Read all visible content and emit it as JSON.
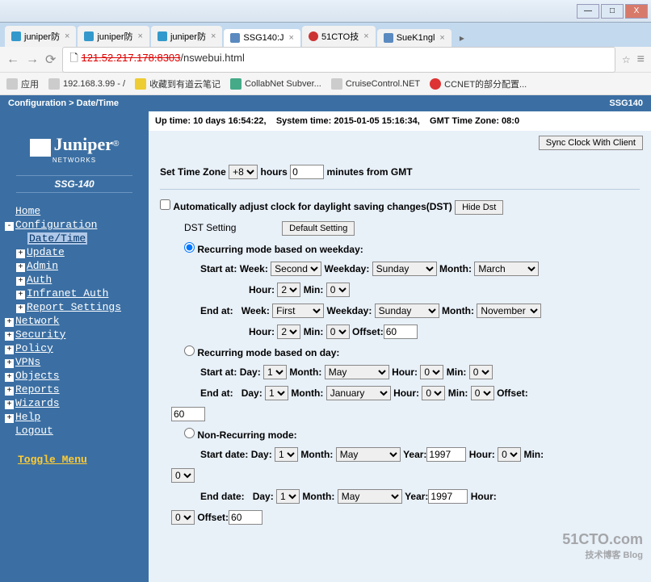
{
  "window": {
    "min": "—",
    "max": "□",
    "close": "X"
  },
  "tabs": [
    {
      "label": "juniper防"
    },
    {
      "label": "juniper防"
    },
    {
      "label": "juniper防"
    },
    {
      "label": "SSG140:J",
      "active": true
    },
    {
      "label": "51CTO技"
    },
    {
      "label": "SueK1ngl"
    }
  ],
  "addr": {
    "url_suffix": "/nswebui.html",
    "star": "☆"
  },
  "bookmarks": {
    "apps": "应用",
    "ip": "192.168.3.99 - /",
    "youdao": "收藏到有道云笔记",
    "collab": "CollabNet Subver...",
    "cruise": "CruiseControl.NET",
    "ccnet": "CCNET的部分配置..."
  },
  "breadcrumb": "Configuration > Date/Time",
  "topright": "SSG140",
  "logo": {
    "brand": "Juniper",
    "sub": "NETWORKS",
    "reg": "®"
  },
  "model": "SSG-140",
  "nav": {
    "home": "Home",
    "configuration": "Configuration",
    "datetime": "Date/Time",
    "update": "Update",
    "admin": "Admin",
    "auth": "Auth",
    "infranet": "Infranet Auth",
    "report": "Report Settings",
    "network": "Network",
    "security": "Security",
    "policy": "Policy",
    "vpns": "VPNs",
    "objects": "Objects",
    "reports": "Reports",
    "wizards": "Wizards",
    "help": "Help",
    "logout": "Logout",
    "toggle": "Toggle Menu"
  },
  "status": {
    "uptime_label": "Up time:",
    "uptime": "10 days 16:54:22,",
    "systime_label": "System time:",
    "systime": "2015-01-05 15:16:34,",
    "gmt_label": "GMT Time Zone:",
    "gmt": "08:0"
  },
  "buttons": {
    "sync": "Sync Clock With Client",
    "hide_dst": "Hide Dst",
    "default": "Default Setting"
  },
  "tz": {
    "label": "Set Time Zone",
    "hours_val": "+8",
    "hours_lbl": "hours",
    "minutes_val": "0",
    "minutes_lbl": "minutes  from GMT"
  },
  "dst": {
    "auto_label": "Automatically adjust clock for daylight saving changes(DST)",
    "setting_label": "DST Setting",
    "mode_weekday": "Recurring mode based on weekday:",
    "mode_day": "Recurring mode based on day:",
    "mode_non": "Non-Recurring mode:",
    "start_at": "Start at:",
    "end_at": "End at:",
    "start_date": "Start date:",
    "end_date": "End date:",
    "week": "Week:",
    "weekday": "Weekday:",
    "month": "Month:",
    "day": "Day:",
    "hour": "Hour:",
    "min": "Min:",
    "year": "Year:",
    "offset": "Offset:",
    "week_start": "Second",
    "week_end": "First",
    "weekday_val": "Sunday",
    "month_start_w": "March",
    "month_end_w": "November",
    "hour_val": "2",
    "min_val": "0",
    "offset_val": "60",
    "day_val": "1",
    "month_start_d": "May",
    "month_end_d": "January",
    "hour_d": "0",
    "min_d": "0",
    "year_val": "1997",
    "month_non": "May"
  },
  "watermark": {
    "main": "51CTO.com",
    "sub": "技术博客  Blog"
  }
}
